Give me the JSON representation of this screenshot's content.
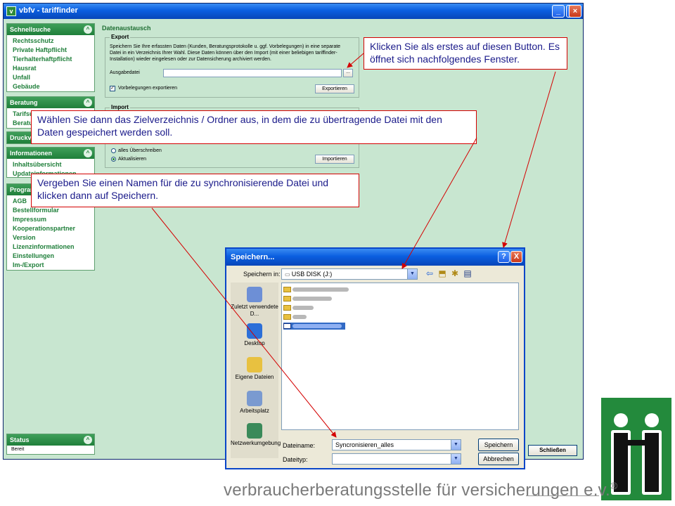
{
  "window": {
    "title": "vbfv - tariffinder",
    "icon": "app-icon"
  },
  "sidebar": {
    "schnellsuche": {
      "title": "Schnellsuche",
      "items": [
        "Rechtsschutz",
        "Private Haftpflicht",
        "Tierhalterhaftpflicht",
        "Hausrat",
        "Unfall",
        "Gebäude"
      ]
    },
    "beratung": {
      "title": "Beratung",
      "items": [
        "Tarifsuche",
        "Beratu"
      ]
    },
    "druckv": {
      "title": "Druckv"
    },
    "informationen": {
      "title": "Informationen",
      "items": [
        "Inhaltsübersicht",
        "Updateinformationen"
      ]
    },
    "programm": {
      "title": "Program",
      "items": [
        "AGB",
        "Bestellformular",
        "Impressum",
        "Kooperationspartner",
        "Version",
        "Lizenzinformationen",
        "Einstellungen",
        "Im-/Export"
      ]
    },
    "status": {
      "title": "Status",
      "text": "Bereit"
    }
  },
  "content": {
    "title": "Datenaustausch",
    "export": {
      "title": "Export",
      "description": "Speichern Sie Ihre erfassten Daten (Kunden, Beratungsprotokolle u. ggf. Vorbelegungen) in eine separate Datei in ein Verzeichnis Ihrer Wahl. Diese Daten können über den Import (mit einer beliebigen tariffinder-Installation) wieder eingelesen oder zur Datensicherung archiviert werden.",
      "field_label": "Ausgabedatei",
      "field_value": "",
      "browse_label": "...",
      "checkbox_label": "Vorbelegungen exportieren",
      "checkbox_checked": true,
      "button_label": "Exportieren"
    },
    "import": {
      "title": "Import",
      "radio1": "alles Überschreiben",
      "radio2": "Aktualisieren",
      "button_label": "Importieren"
    },
    "close_label": "Schließen"
  },
  "callouts": {
    "c1": "Klicken Sie als erstes auf diesen Button. Es öffnet sich nachfolgendes Fenster.",
    "c2": "Wählen Sie dann das Zielverzeichnis / Ordner aus, in dem die zu übertragende Datei mit den Daten gespeichert werden soll.",
    "c3": "Vergeben Sie einen Namen für die zu synchronisierende Datei und klicken dann auf Speichern."
  },
  "dialog": {
    "title": "Speichern...",
    "help": "?",
    "close": "X",
    "save_in_label": "Speichern in:",
    "save_in_value": "USB DISK (J:)",
    "places": [
      "Zuletzt verwendete D...",
      "Desktop",
      "Eigene Dateien",
      "Arbeitsplatz",
      "Netzwerkumgebung"
    ],
    "filename_label": "Dateiname:",
    "filename_value": "Syncronisieren_alles",
    "filetype_label": "Dateityp:",
    "filetype_value": "",
    "save_button": "Speichern",
    "cancel_button": "Abbrechen"
  },
  "footer": {
    "text": "verbraucherberatungsstelle für versicherungen e.v.",
    "mark": "®"
  },
  "colors": {
    "accent": "#238a3c",
    "callout_border": "#d40000",
    "callout_text": "#1a1a8a",
    "window_bg": "#c8e6d0"
  }
}
